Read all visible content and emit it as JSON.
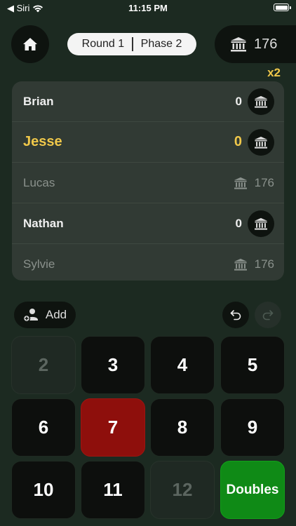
{
  "status_bar": {
    "carrier": "◀ Siri",
    "time": "11:15 PM"
  },
  "header": {
    "round_label": "Round 1",
    "phase_label": "Phase 2",
    "bank_total": "176",
    "multiplier": "x2"
  },
  "players": [
    {
      "name": "Brian",
      "score": "0",
      "state": "active"
    },
    {
      "name": "Jesse",
      "score": "0",
      "state": "current"
    },
    {
      "name": "Lucas",
      "banked": "176",
      "state": "banked"
    },
    {
      "name": "Nathan",
      "score": "0",
      "state": "active"
    },
    {
      "name": "Sylvie",
      "banked": "176",
      "state": "banked"
    }
  ],
  "controls": {
    "add_label": "Add"
  },
  "keypad": {
    "keys": [
      {
        "label": "2",
        "state": "disabled"
      },
      {
        "label": "3",
        "state": "normal"
      },
      {
        "label": "4",
        "state": "normal"
      },
      {
        "label": "5",
        "state": "normal"
      },
      {
        "label": "6",
        "state": "normal"
      },
      {
        "label": "7",
        "state": "red"
      },
      {
        "label": "8",
        "state": "normal"
      },
      {
        "label": "9",
        "state": "normal"
      },
      {
        "label": "10",
        "state": "normal"
      },
      {
        "label": "11",
        "state": "normal"
      },
      {
        "label": "12",
        "state": "disabled"
      },
      {
        "label": "Doubles",
        "state": "green"
      }
    ]
  },
  "colors": {
    "background": "#1c2a21",
    "accent": "#f0c84a",
    "seven": "#8e0f0c",
    "doubles": "#0f8a16"
  }
}
